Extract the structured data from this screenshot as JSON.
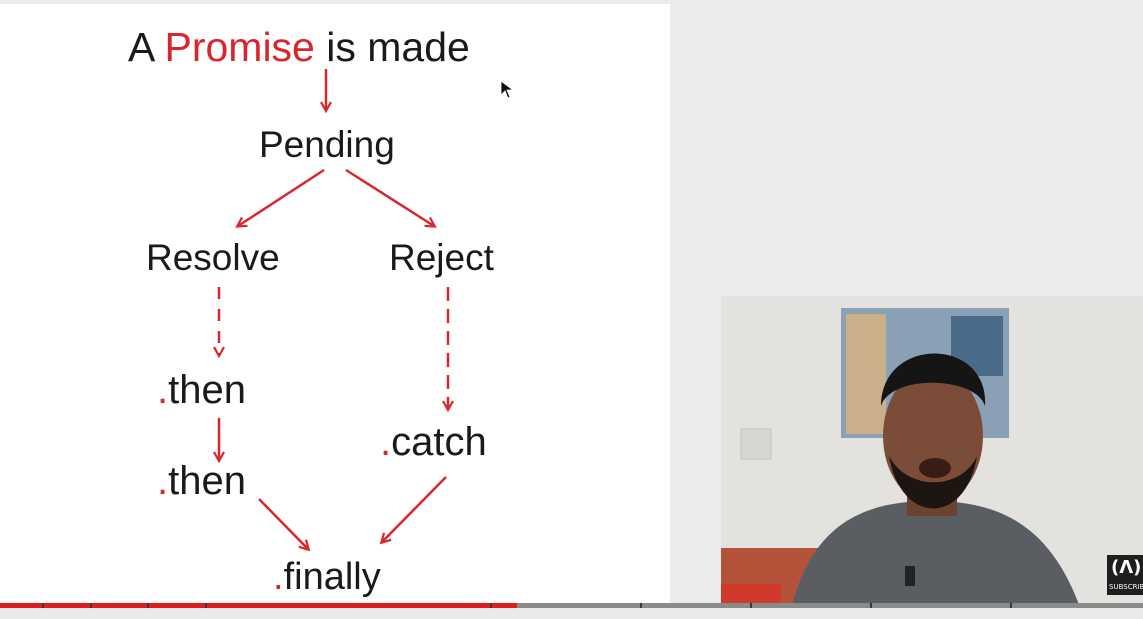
{
  "slide": {
    "title_prefix": "A ",
    "title_highlight": "Promise",
    "title_suffix": " is made",
    "pending": "Pending",
    "resolve": "Resolve",
    "reject": "Reject",
    "then1_dot": ".",
    "then1": "then",
    "then2_dot": ".",
    "then2": "then",
    "catch_dot": ".",
    "catch": "catch",
    "finally_dot": ".",
    "finally": "finally"
  },
  "badge": {
    "glyph": "(Λ)",
    "label": "SUBSCRIBE"
  },
  "player": {
    "progress_fraction": 0.452
  },
  "colors": {
    "accent_red": "#d9262c",
    "text": "#1a1a1a",
    "progress_red": "#e21d1d"
  }
}
